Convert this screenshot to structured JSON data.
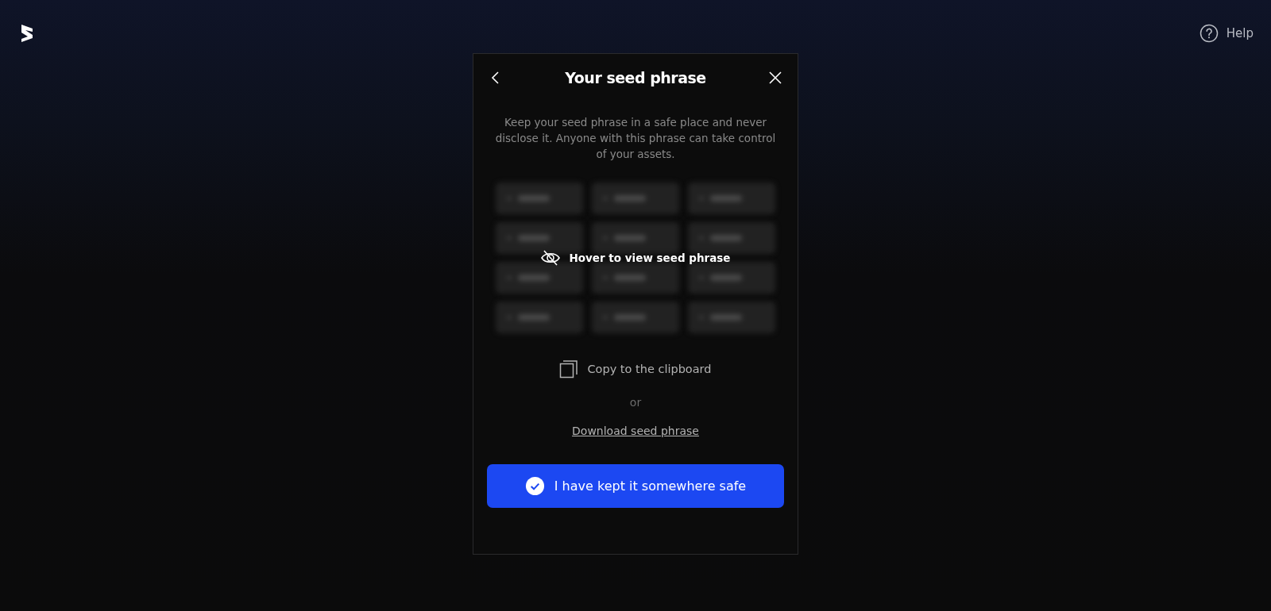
{
  "header": {
    "help_label": "Help"
  },
  "modal": {
    "title": "Your seed phrase",
    "description": "Keep your seed phrase in a safe place and never disclose it. Anyone with this phrase can take control of your assets.",
    "seed_tiles": [
      {
        "kind": "blurred"
      },
      {
        "kind": "blurred"
      },
      {
        "kind": "blurred"
      },
      {
        "kind": "blurred"
      },
      {
        "kind": "blurred"
      },
      {
        "kind": "blurred"
      },
      {
        "kind": "blurred"
      },
      {
        "kind": "blurred"
      },
      {
        "kind": "blurred"
      },
      {
        "kind": "blurred"
      },
      {
        "kind": "blurred"
      },
      {
        "kind": "blurred"
      }
    ],
    "reveal_hint": "Hover to view seed phrase",
    "copy_label": "Copy to the clipboard",
    "separator": "or",
    "download_link": "Download seed phrase",
    "confirm_button": "I have kept it somewhere safe"
  }
}
